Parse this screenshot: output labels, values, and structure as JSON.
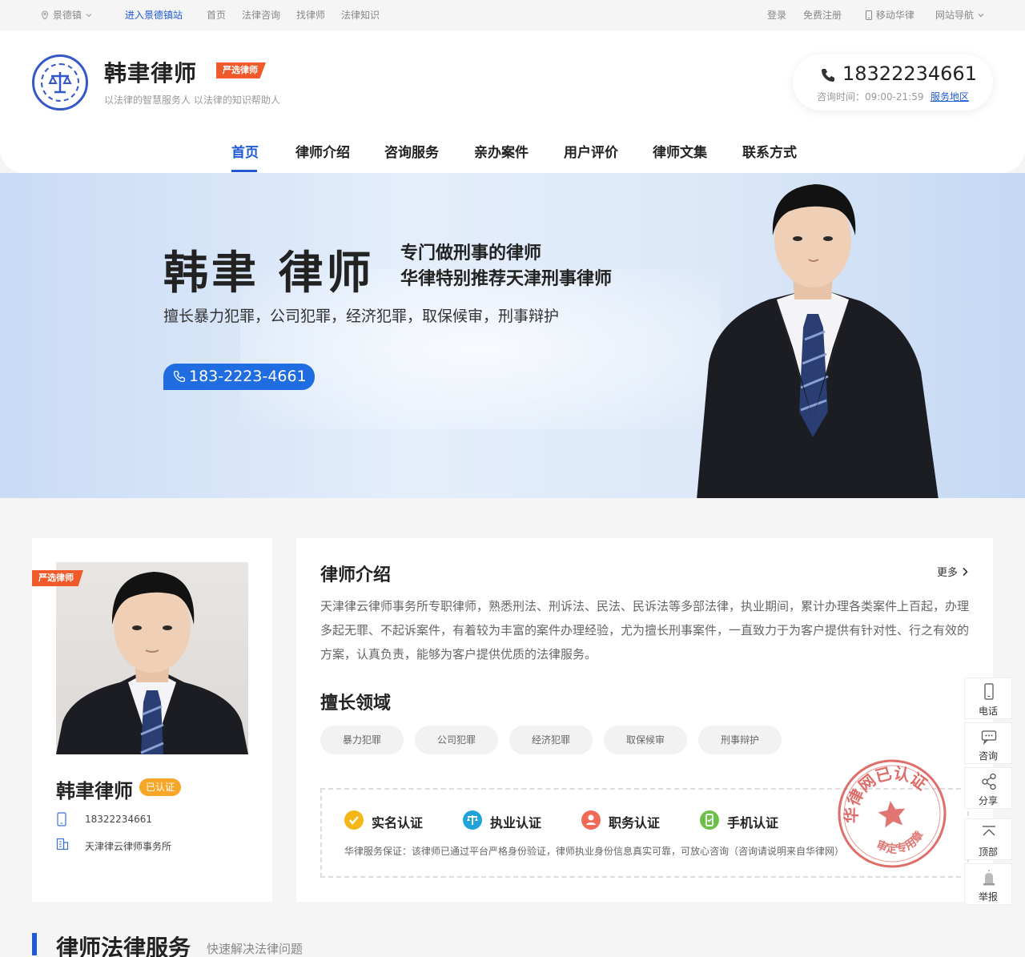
{
  "topbar": {
    "city": "景德镇",
    "enter_site": "进入景德镇站",
    "links": [
      "首页",
      "法律咨询",
      "找律师",
      "法律知识"
    ],
    "login": "登录",
    "register": "免费注册",
    "mobile": "移动华律",
    "sitenav": "网站导航"
  },
  "header": {
    "name": "韩聿律师",
    "badge": "严选律师",
    "slogan": "以法律的智慧服务人 以法律的知识帮助人",
    "phone": "18322234661",
    "hours": "咨询时间：09:00-21:59",
    "service_area": "服务地区"
  },
  "nav": {
    "items": [
      "首页",
      "律师介绍",
      "咨询服务",
      "亲办案件",
      "用户评价",
      "律师文集",
      "联系方式"
    ],
    "active": "首页"
  },
  "hero": {
    "name": "韩聿  律师",
    "tag1": "专门做刑事的律师",
    "tag2": "华律特别推荐天津刑事律师",
    "skills": "擅长暴力犯罪，公司犯罪，经济犯罪，取保候审，刑事辩护",
    "phone": "183-2223-4661"
  },
  "profile": {
    "badge": "严选律师",
    "name": "韩聿律师",
    "verified": "已认证",
    "phone": "18322234661",
    "firm": "天津律云律师事务所"
  },
  "intro": {
    "title": "律师介绍",
    "more": "更多",
    "text": "天津律云律师事务所专职律师，熟悉刑法、刑诉法、民法、民诉法等多部法律，执业期间，累计办理各类案件上百起，办理多起无罪、不起诉案件，有着较为丰富的案件办理经验，尤为擅长刑事案件，一直致力于为客户提供有针对性、行之有效的方案，认真负责，能够为客户提供优质的法律服务。",
    "areas_title": "擅长领域",
    "areas": [
      "暴力犯罪",
      "公司犯罪",
      "经济犯罪",
      "取保候审",
      "刑事辩护"
    ],
    "certs": [
      "实名认证",
      "执业认证",
      "职务认证",
      "手机认证"
    ],
    "cert_note": "华律服务保证：该律师已通过平台严格身份验证，律师执业身份信息真实可靠，可放心咨询（咨询请说明来自华律网）",
    "stamp_top": "华律网已认证",
    "stamp_bottom": "审定专用章"
  },
  "sidebar": {
    "items": [
      "电话",
      "咨询",
      "分享",
      "顶部",
      "举报"
    ]
  },
  "section": {
    "title": "律师法律服务",
    "subtitle": "快速解决法律问题"
  },
  "colors": {
    "brand_blue": "#1f5ad6",
    "badge_orange": "#f05a2b",
    "verified_yellow": "#f7a627"
  }
}
